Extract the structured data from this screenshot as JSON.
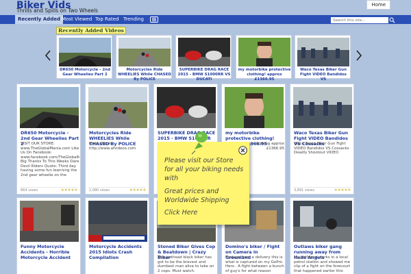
{
  "header": {
    "site_title": "Biker Vids",
    "tagline": "Thrills and Spills on Two Wheels",
    "home_button": "Home"
  },
  "nav": {
    "items": [
      "Recently Added",
      "Most Viewed",
      "Top Rated",
      "Trending"
    ],
    "active": "Recently Added",
    "search_placeholder": "Search this site..."
  },
  "recent": {
    "heading": "Recently Added Videos",
    "items": [
      {
        "title": "DR650 Motorcycle - 2nd Gear Wheelies Part 2"
      },
      {
        "title": "Motorcycles Ride WHEELIES While CHASED By POLICE"
      },
      {
        "title": "SUPERBIKE DRAG RACE 2015 - BMW S1000RR VS DUCATI"
      },
      {
        "title": "my motorbike protective clothing! approx £1366.95"
      },
      {
        "title": "Waco Texas Biker Gun Fight VIDEO Bandidos VS"
      }
    ]
  },
  "grid": {
    "row1": [
      {
        "title": "DR650 Motorcycle - 2nd Gear Wheelies Part 2",
        "desc": "VISIT OUR STORE: www.TheGlobalMania.com Like Us On Facebook: www.facebook.com/TheGlobalMania Big Thanks To This Weeks Dare Devil Riders Quote: Third day having some fun leanning the 2nd gear wheelie on the",
        "views": "664 views"
      },
      {
        "title": "Motorcycles Ride WHEELIES While CHASED By POLICE",
        "desc": "More clip at: http://www.afvideos.com",
        "views": "1,080 views"
      },
      {
        "title": "SUPERBIKE DRAG RACE 2015 - BMW S1000RR VS DUCATI",
        "desc": "",
        "views": ""
      },
      {
        "title": "my motorbike protective clothing! approx £1366.95",
        "desc": "... protective clothing approx £1366.95",
        "views": ""
      },
      {
        "title": "Waco Texas Biker Gun Fight VIDEO Bandidos VS Cossacks",
        "desc": "Waco Texas Biker Gun Fight VIDEO Bandidos VS Cossacks Deadly Shootout VIDEO",
        "views": "3,891 views"
      }
    ],
    "row2": [
      {
        "title": "Funny Motorcycle Accidents - Horrible Motorcycle Accident",
        "desc": ""
      },
      {
        "title": "Motorcycle Accidents 2015 Idiots Crash Compilation",
        "desc": ""
      },
      {
        "title": "Stoned Biker Gives Cop & Beatdown | Crazy Biker",
        "desc": "This pothead black biker has got to be the bravest and dumbest man alive to take on 2 cops. Must watch."
      },
      {
        "title": "Domino's biker / Fight on Camera in Greenland",
        "desc": "Footage from a delivery this is what is captured on my GoPro Hero . A fight between a bunch of guy's for what reason"
      },
      {
        "title": "Outlaws biker gang running away from Hells Angels",
        "desc": "My girlfriend works in a local petrol station and showed me clip of a fight on the forecourt that happened earlier this year."
      }
    ]
  },
  "sticky": {
    "lines": [
      "Please visit our Store",
      "for all your biking needs",
      "with",
      "Great prices and",
      "Worldwide Shipping",
      "Click Here"
    ]
  },
  "colors": {
    "nav_bar": "#2a4fb6",
    "background": "#afc3df",
    "title_blue": "#1f3a9a",
    "sticky_yellow": "#fff571"
  }
}
